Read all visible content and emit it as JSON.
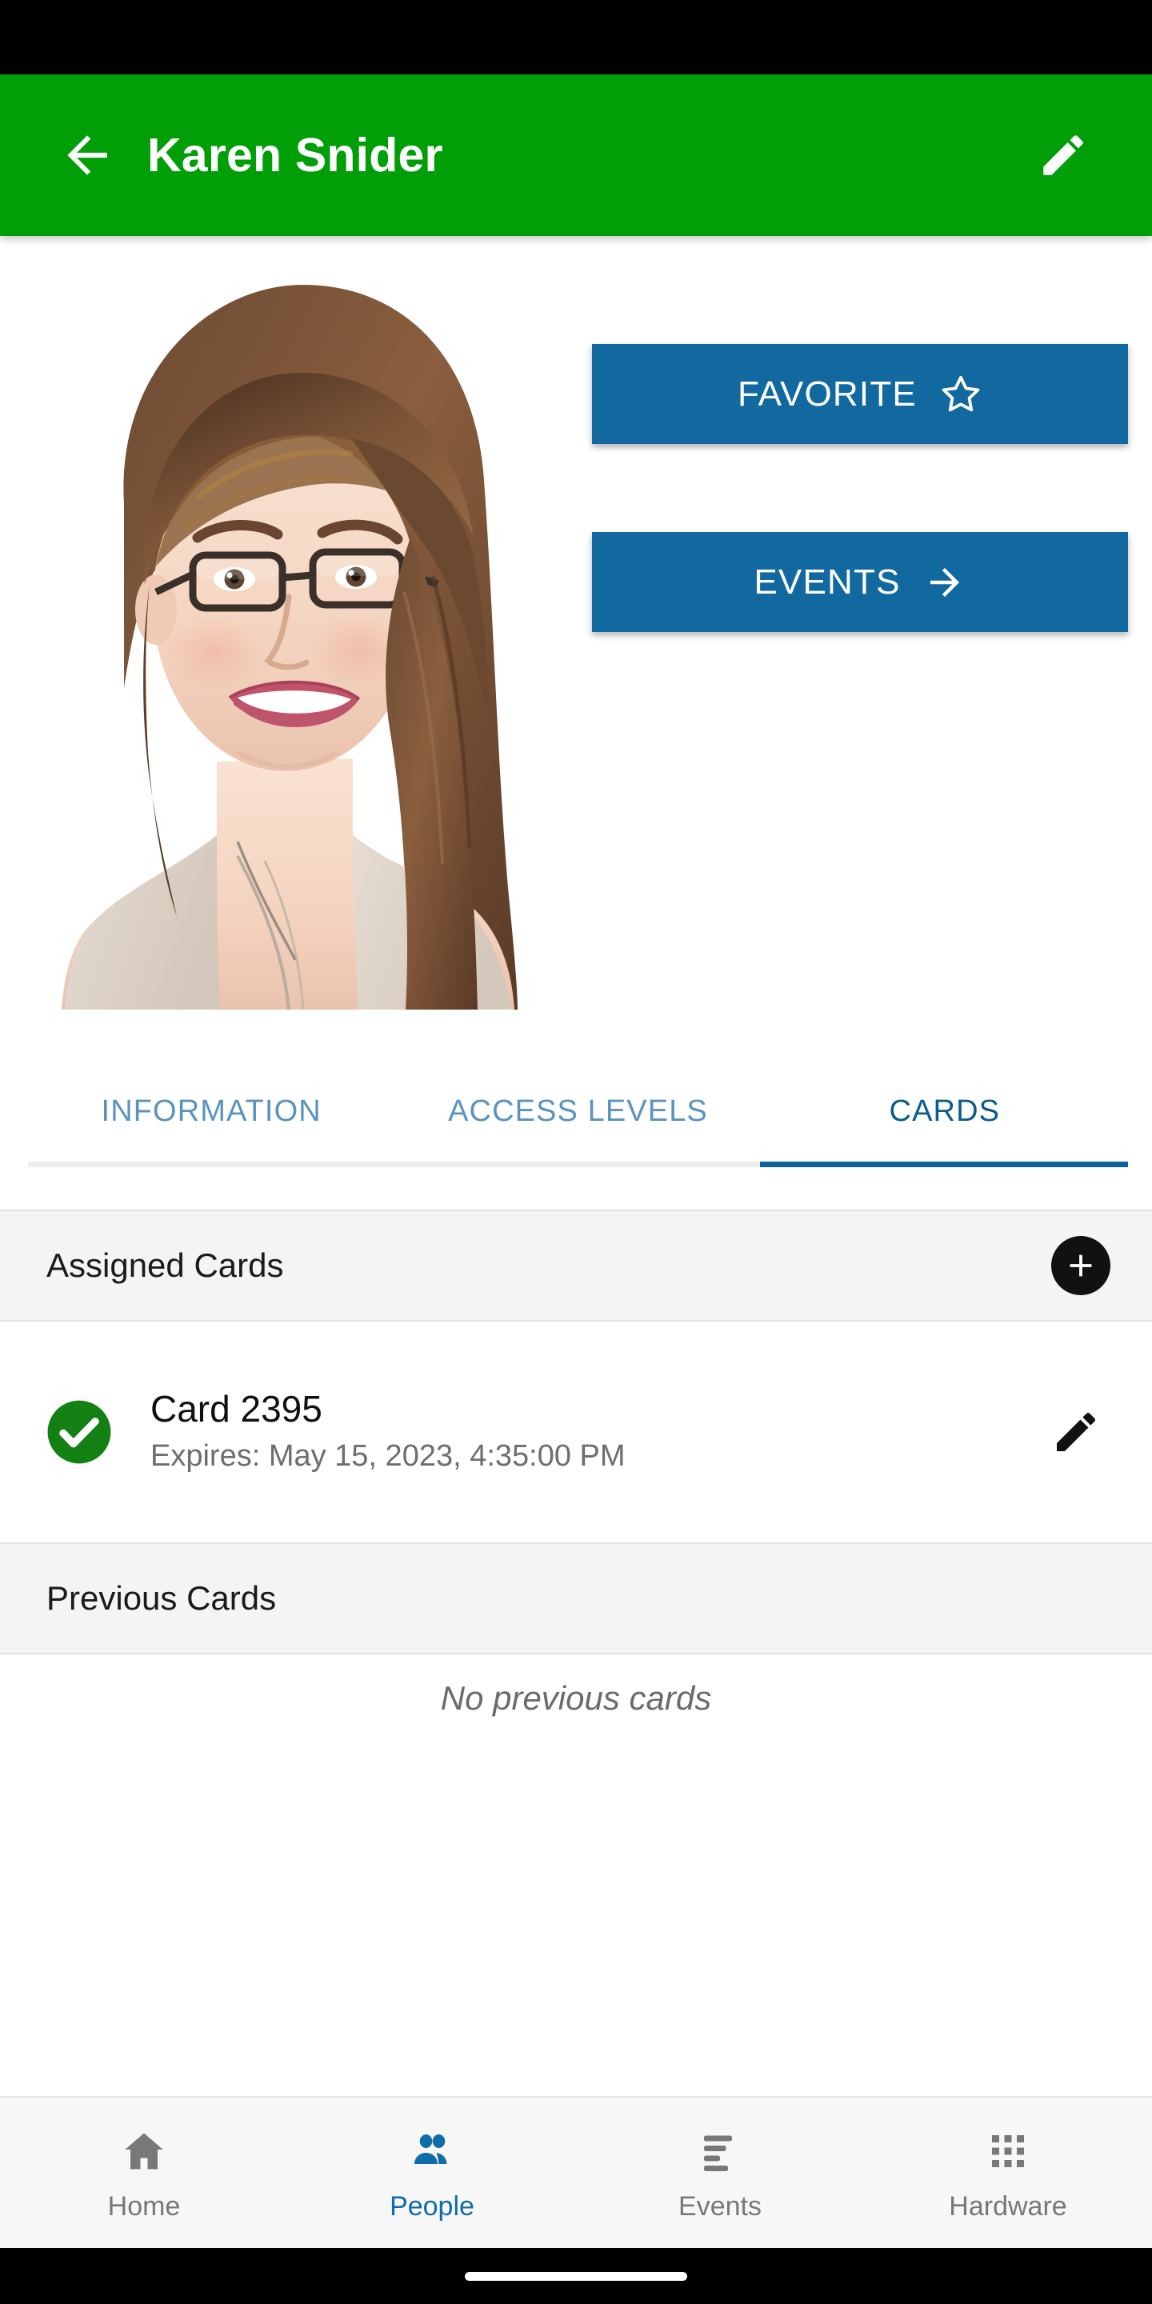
{
  "app_bar": {
    "back_icon": "arrow-left-icon",
    "title": "Karen Snider",
    "edit_icon": "pencil-edit-icon",
    "background_color": "#009E07"
  },
  "profile": {
    "photo_alt": "portrait-photo-karen-snider"
  },
  "actions": [
    {
      "label": "FAVORITE",
      "icon": "star-outline-icon",
      "color": "#12699F"
    },
    {
      "label": "EVENTS",
      "icon": "arrow-right-icon",
      "color": "#12699F"
    }
  ],
  "tabs": {
    "items": [
      {
        "label": "INFORMATION",
        "active": false
      },
      {
        "label": "ACCESS LEVELS",
        "active": false
      },
      {
        "label": "CARDS",
        "active": true
      }
    ],
    "active_color": "#0A5C8F",
    "inactive_color": "#5B93C0",
    "indicator_color": "#0C639C"
  },
  "assigned_section": {
    "title": "Assigned Cards",
    "add_icon": "plus-circle-icon"
  },
  "cards": [
    {
      "status_icon": "check-circle-icon",
      "status_color": "#128012",
      "title": "Card 2395",
      "subtitle": "Expires: May 15, 2023, 4:35:00 PM",
      "edit_icon": "pencil-edit-icon"
    }
  ],
  "previous_section": {
    "title": "Previous Cards",
    "empty_message": "No previous cards"
  },
  "bottom_nav": {
    "items": [
      {
        "label": "Home",
        "icon": "home-icon",
        "active": false
      },
      {
        "label": "People",
        "icon": "people-icon",
        "active": true
      },
      {
        "label": "Events",
        "icon": "list-icon",
        "active": false
      },
      {
        "label": "Hardware",
        "icon": "grid-dots-icon",
        "active": false
      }
    ],
    "active_color": "#0E6DA8",
    "inactive_color": "#787878"
  }
}
